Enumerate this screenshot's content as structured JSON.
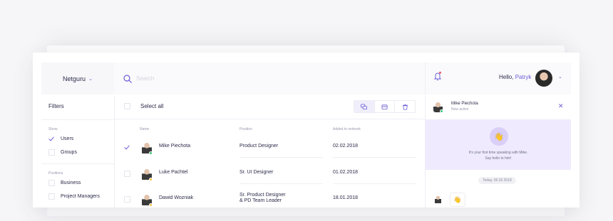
{
  "brand": {
    "label": "Netguru"
  },
  "search": {
    "placeholder": "Search"
  },
  "user": {
    "greeting": "Hello,",
    "name": "Patryk"
  },
  "filters": {
    "title": "Filters",
    "show_label": "Show",
    "show_items": [
      {
        "label": "Users",
        "checked": true
      },
      {
        "label": "Groups",
        "checked": false
      }
    ],
    "positions_label": "Positions",
    "position_items": [
      {
        "label": "Business",
        "checked": false
      },
      {
        "label": "Project Managers",
        "checked": false
      }
    ]
  },
  "toolbar": {
    "select_all": "Select all",
    "tools": [
      {
        "icon": "chat-icon",
        "active": true
      },
      {
        "icon": "card-icon",
        "active": false
      },
      {
        "icon": "trash-icon",
        "active": false
      }
    ]
  },
  "table": {
    "headers": {
      "name": "Name",
      "position": "Position",
      "added": "Added to network"
    },
    "rows": [
      {
        "name": "Mike Piechota",
        "position": "Product Designer",
        "position_line2": "",
        "added": "02.02.2018",
        "checked": true,
        "status_color": "#3bc67a"
      },
      {
        "name": "Luke Pachtel",
        "position": "Sr. UI Designer",
        "position_line2": "",
        "added": "01.02.2018",
        "checked": false,
        "status_color": "#f5c542"
      },
      {
        "name": "Dawid Wozniak",
        "position": "Sr. Product Designer",
        "position_line2": "& PD Team Leader",
        "added": "18.01.2018",
        "checked": false,
        "status_color": "#f5c542"
      }
    ]
  },
  "chat": {
    "name": "Mike Piechota",
    "status": "Now active",
    "intro_line1": "It's your first time speaking with Mike.",
    "intro_line2": "Say hello to him!",
    "day": "Today, 05.02.2018"
  },
  "colors": {
    "accent": "#6b5cd6",
    "online": "#3bc67a",
    "away": "#f5c542",
    "highlight": "#efeafd"
  }
}
